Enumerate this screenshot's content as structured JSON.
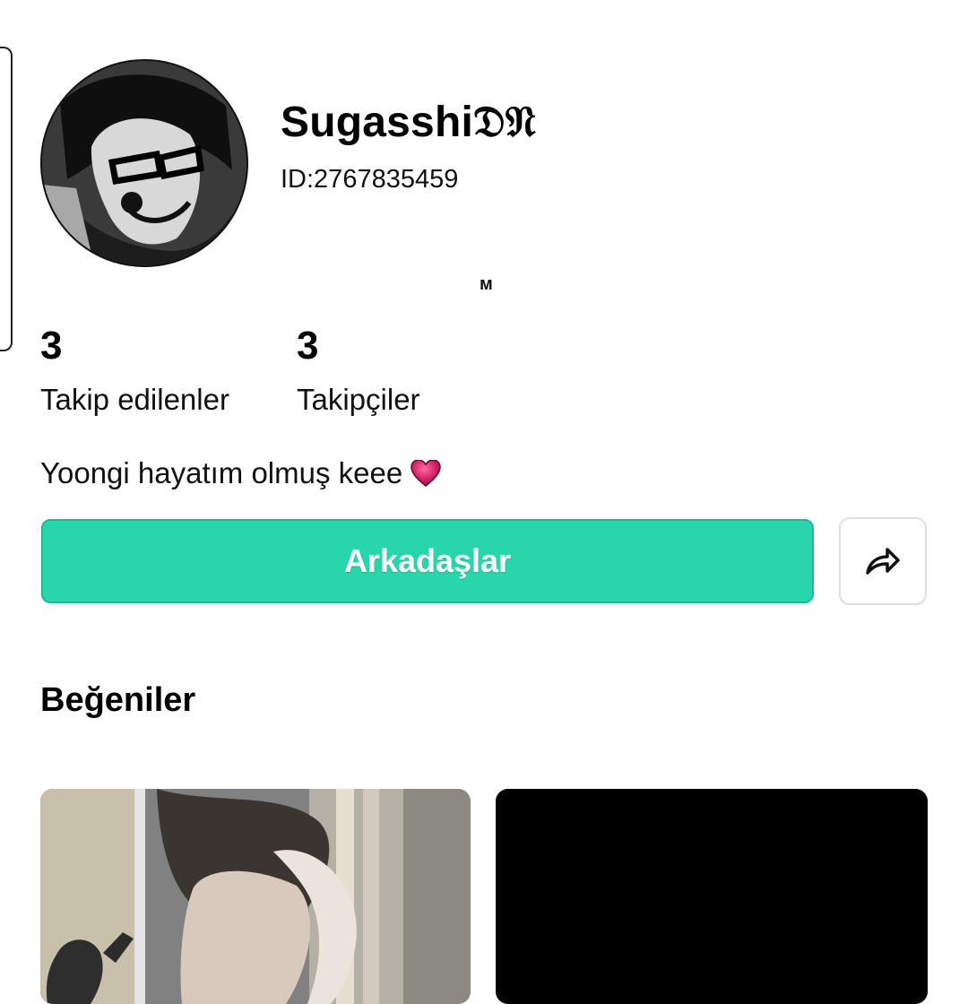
{
  "profile": {
    "username": "Sugasshi𝔇𝔑",
    "id_text": "ID:2767835459",
    "small_mark": "ᴍ",
    "bio": "Yoongi hayatım olmuş keee"
  },
  "stats": [
    {
      "count": "3",
      "label": "Takip edilenler"
    },
    {
      "count": "3",
      "label": "Takipçiler"
    }
  ],
  "actions": {
    "friends_button": "Arkadaşlar",
    "share_icon": "share-icon"
  },
  "likes": {
    "section_title": "Beğeniler"
  },
  "colors": {
    "accent": "#29d6ab",
    "background": "#ffffff",
    "text": "#111111"
  },
  "icons": [
    "heart-icon",
    "share-icon"
  ]
}
